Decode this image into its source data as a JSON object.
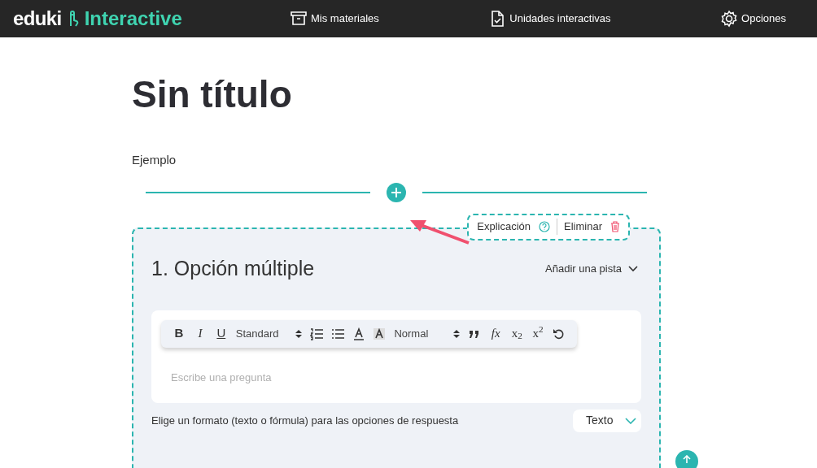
{
  "header": {
    "logo": "eduki",
    "logo_suffix": "Interactive",
    "nav": [
      {
        "kind": "box",
        "label": "Mis materiales"
      },
      {
        "kind": "doc",
        "label": "Unidades interactivas"
      },
      {
        "kind": "gear",
        "label": "Opciones"
      }
    ]
  },
  "title": "Sin título",
  "section_label": "Ejemplo",
  "question": {
    "actions": [
      {
        "kind": "help",
        "label": "Explicación"
      },
      {
        "kind": "delete",
        "label": "Eliminar"
      }
    ],
    "title": "1. Opción múltiple",
    "hint_label": "Añadir una pista",
    "toolbar": [
      {
        "kind": "bold",
        "label": "B"
      },
      {
        "kind": "italic",
        "label": "I"
      },
      {
        "kind": "underline",
        "label": "U"
      },
      {
        "kind": "select",
        "label": "Standard"
      },
      {
        "kind": "ordered-list"
      },
      {
        "kind": "bullet-list"
      },
      {
        "kind": "text-color"
      },
      {
        "kind": "background-color"
      },
      {
        "kind": "select",
        "label": "Normal"
      },
      {
        "kind": "quote"
      },
      {
        "kind": "formula",
        "label": "fx"
      },
      {
        "kind": "subscript",
        "label": "x$_{2}$"
      },
      {
        "kind": "superscript",
        "label": "x$^{2}$"
      },
      {
        "kind": "undo"
      }
    ],
    "placeholder": "Escribe una pregunta",
    "format_prompt": "Elige un formato (texto o fórmula) para las opciones de respuesta",
    "format_value": "Texto"
  }
}
